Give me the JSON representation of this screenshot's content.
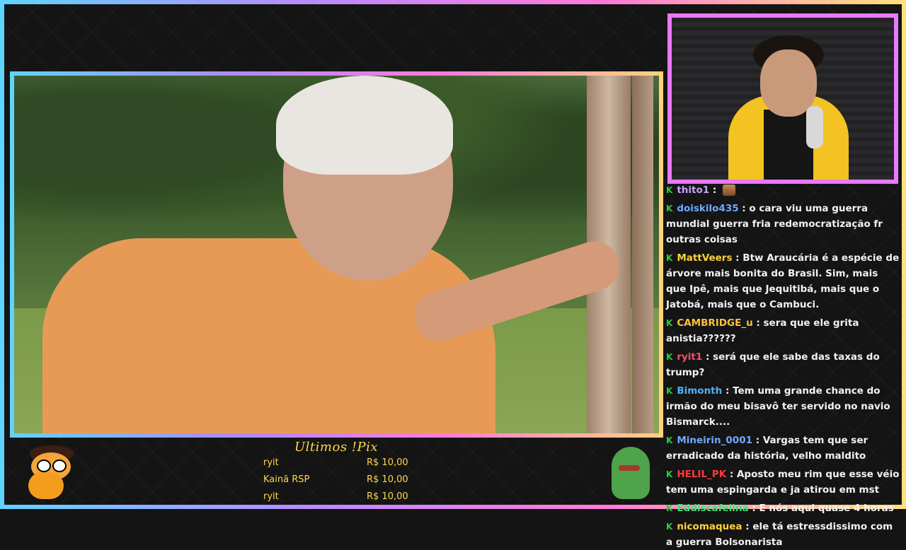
{
  "chat": {
    "messages": [
      {
        "user": "thito1",
        "color": "#c8a2ff",
        "text": "",
        "emote": true
      },
      {
        "user": "doiskilo435",
        "color": "#6fa8ff",
        "text": "o cara viu uma guerra mundial guerra fria redemocratização fr outras coisas"
      },
      {
        "user": "MattVeers",
        "color": "#ffd23a",
        "text": "Btw Araucária é a espécie de árvore mais bonita do Brasil. Sim, mais que Ipê, mais que Jequitibá, mais que o Jatobá, mais que o Cambuci."
      },
      {
        "user": "CAMBRIDGE_u",
        "color": "#ffc23a",
        "text": "sera que ele grita anistia??????"
      },
      {
        "user": "ryit1",
        "color": "#ff4d6a",
        "text": "será que ele sabe das taxas do trump?"
      },
      {
        "user": "Bimonth",
        "color": "#4fb3ff",
        "text": "Tem uma grande chance do irmão do meu bisavô ter servido no navio Bismarck...."
      },
      {
        "user": "Mineirin_0001",
        "color": "#6fa8ff",
        "text": "Vargas tem que ser erradicado da história, velho maldito"
      },
      {
        "user": "HELIL_PK",
        "color": "#ff3b3b",
        "text": "Aposto meu rim que esse véio tem uma espingarda e ja atirou em mst"
      },
      {
        "user": "Eddiscafeiina",
        "color": "#3ee07a",
        "text": "E nós aqui quase 4 horas"
      },
      {
        "user": "nicomaquea",
        "color": "#ffd23a",
        "text": "ele tá estressdissimo com a guerra Bolsonarista"
      }
    ]
  },
  "pix": {
    "title": "Ultimos !Pix",
    "entries": [
      {
        "name": "ryit",
        "amount": "R$ 10,00"
      },
      {
        "name": "Kainã RSP",
        "amount": "R$ 10,00"
      },
      {
        "name": "ryit",
        "amount": "R$ 10,00"
      }
    ]
  },
  "colors": {
    "pix_text": "#ffd84d",
    "frame_gradient": [
      "#5fd4ff",
      "#b88cff",
      "#ff7ad9",
      "#ffe27a"
    ],
    "cam_border": "#e979ff",
    "badge": "#2ecc40"
  }
}
